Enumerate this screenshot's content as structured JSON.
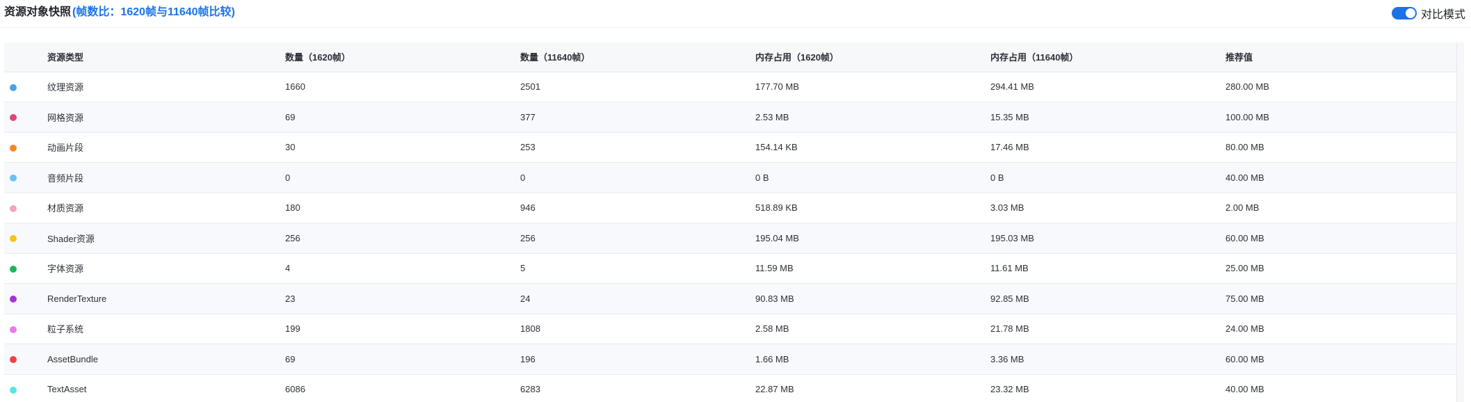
{
  "header": {
    "title": "资源对象快照",
    "subtitle": "(帧数比：1620帧与11640帧比较)",
    "mode_label": "对比模式",
    "mode_on": true
  },
  "table": {
    "columns": [
      "",
      "资源类型",
      "数量（1620帧）",
      "数量（11640帧）",
      "内存占用（1620帧）",
      "内存占用（11640帧）",
      "推荐值"
    ],
    "rows": [
      {
        "color": "#4aa3e8",
        "type": "纹理资源",
        "count_1620": "1660",
        "count_11640": "2501",
        "mem_1620": "177.70 MB",
        "mem_11640": "294.41 MB",
        "recommended": "280.00 MB"
      },
      {
        "color": "#e0467c",
        "type": "网格资源",
        "count_1620": "69",
        "count_11640": "377",
        "mem_1620": "2.53 MB",
        "mem_11640": "15.35 MB",
        "recommended": "100.00 MB"
      },
      {
        "color": "#f0892a",
        "type": "动画片段",
        "count_1620": "30",
        "count_11640": "253",
        "mem_1620": "154.14 KB",
        "mem_11640": "17.46 MB",
        "recommended": "80.00 MB"
      },
      {
        "color": "#6bc0f5",
        "type": "音频片段",
        "count_1620": "0",
        "count_11640": "0",
        "mem_1620": "0 B",
        "mem_11640": "0 B",
        "recommended": "40.00 MB"
      },
      {
        "color": "#f2a6bd",
        "type": "材质资源",
        "count_1620": "180",
        "count_11640": "946",
        "mem_1620": "518.89 KB",
        "mem_11640": "3.03 MB",
        "recommended": "2.00 MB"
      },
      {
        "color": "#f5c518",
        "type": "Shader资源",
        "count_1620": "256",
        "count_11640": "256",
        "mem_1620": "195.04 MB",
        "mem_11640": "195.03 MB",
        "recommended": "60.00 MB"
      },
      {
        "color": "#1fb45a",
        "type": "字体资源",
        "count_1620": "4",
        "count_11640": "5",
        "mem_1620": "11.59 MB",
        "mem_11640": "11.61 MB",
        "recommended": "25.00 MB"
      },
      {
        "color": "#a533d6",
        "type": "RenderTexture",
        "count_1620": "23",
        "count_11640": "24",
        "mem_1620": "90.83 MB",
        "mem_11640": "92.85 MB",
        "recommended": "75.00 MB"
      },
      {
        "color": "#ee77f0",
        "type": "粒子系统",
        "count_1620": "199",
        "count_11640": "1808",
        "mem_1620": "2.58 MB",
        "mem_11640": "21.78 MB",
        "recommended": "24.00 MB"
      },
      {
        "color": "#ef4343",
        "type": "AssetBundle",
        "count_1620": "69",
        "count_11640": "196",
        "mem_1620": "1.66 MB",
        "mem_11640": "3.36 MB",
        "recommended": "60.00 MB"
      },
      {
        "color": "#54e8e0",
        "type": "TextAsset",
        "count_1620": "6086",
        "count_11640": "6283",
        "mem_1620": "22.87 MB",
        "mem_11640": "23.32 MB",
        "recommended": "40.00 MB"
      }
    ]
  }
}
